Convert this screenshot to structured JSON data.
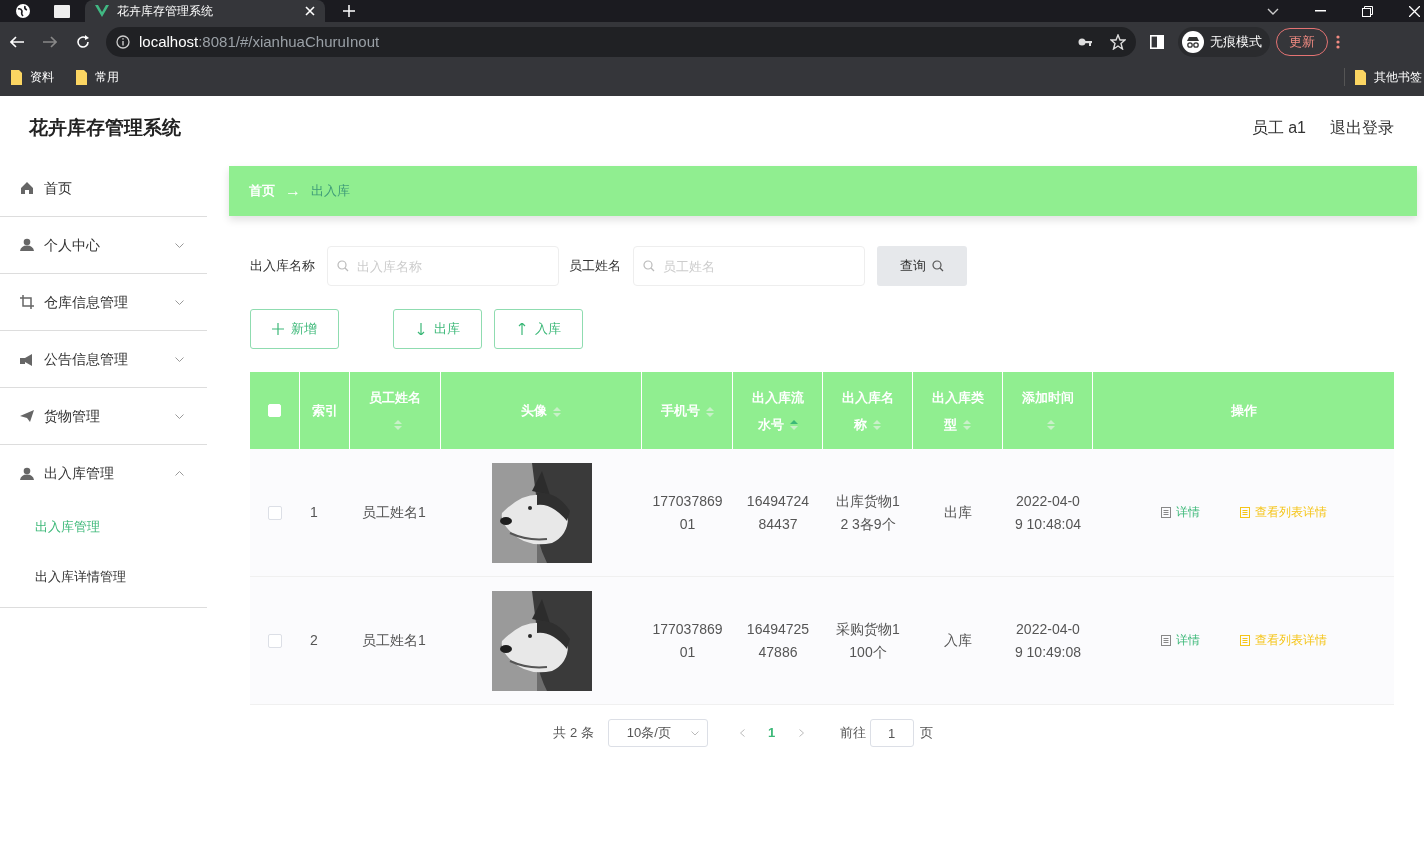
{
  "browser": {
    "tabs": [
      {
        "title": "花卉库存管理系统",
        "selected": true
      }
    ],
    "url_host": "localhost",
    "url_rest": ":8081/#/xianhuaChuruInout",
    "incognito_label": "无痕模式",
    "update_button": "更新",
    "bookmarks": [
      "资料",
      "常用"
    ],
    "other_bookmarks": "其他书签"
  },
  "header": {
    "title": "花卉库存管理系统",
    "user": "员工 a1",
    "logout": "退出登录"
  },
  "sidebar": {
    "items": [
      {
        "label": "首页",
        "kind": "home"
      },
      {
        "label": "个人中心",
        "kind": "user",
        "expanded": false
      },
      {
        "label": "仓库信息管理",
        "kind": "crop",
        "expanded": false
      },
      {
        "label": "公告信息管理",
        "kind": "notice",
        "expanded": false
      },
      {
        "label": "货物管理",
        "kind": "send",
        "expanded": false
      },
      {
        "label": "出入库管理",
        "kind": "user",
        "expanded": true,
        "children": [
          {
            "label": "出入库管理",
            "selected": true
          },
          {
            "label": "出入库详情管理",
            "selected": false
          }
        ]
      }
    ]
  },
  "breadcrumb": {
    "items": [
      "首页",
      "出入库"
    ],
    "separator": "→"
  },
  "search": {
    "fields": [
      {
        "label": "出入库名称",
        "placeholder": "出入库名称"
      },
      {
        "label": "员工姓名",
        "placeholder": "员工姓名"
      }
    ],
    "button": "查询"
  },
  "actions": [
    {
      "label": "新增",
      "kind": "plus"
    },
    {
      "label": "出库",
      "kind": "down"
    },
    {
      "label": "入库",
      "kind": "up"
    }
  ],
  "table": {
    "header_checked": false,
    "columns": [
      {
        "title": "索引",
        "sortable": false
      },
      {
        "title": "员工姓名",
        "sortable": true,
        "sorted_ascending": false
      },
      {
        "title": "头像",
        "sortable": true,
        "sorted_ascending": false
      },
      {
        "title": "手机号",
        "sortable": true,
        "sorted_ascending": false
      },
      {
        "title": "出入库流水号",
        "sortable": true,
        "sorted_ascending": true
      },
      {
        "title": "出入库名称",
        "sortable": true,
        "sorted_ascending": false
      },
      {
        "title": "出入库类型",
        "sortable": true,
        "sorted_ascending": false
      },
      {
        "title": "添加时间",
        "sortable": true,
        "sorted_ascending": false
      },
      {
        "title": "操作",
        "sortable": false
      }
    ],
    "rows": [
      {
        "checked": false,
        "index": "1",
        "name": "员工姓名1",
        "avatar": {
          "kind": "picture"
        },
        "phone": "17703786901",
        "serial": "1649472484437",
        "title": "出库货物12 3各9个",
        "type": "出库",
        "time": "2022-04-09 10:48:04",
        "actions": [
          "详情",
          "查看列表详情"
        ]
      },
      {
        "checked": false,
        "index": "2",
        "name": "员工姓名1",
        "avatar": {
          "kind": "picture"
        },
        "phone": "17703786901",
        "serial": "1649472547886",
        "title": "采购货物1 100个",
        "type": "入库",
        "time": "2022-04-09 10:49:08",
        "actions": [
          "详情",
          "查看列表详情"
        ]
      }
    ]
  },
  "pagination": {
    "total": "共 2 条",
    "page_size": "10条/页",
    "pages": [
      {
        "label": "1",
        "selected": true
      }
    ],
    "goto_label": "前往",
    "goto_value": "1",
    "page_suffix": "页"
  }
}
